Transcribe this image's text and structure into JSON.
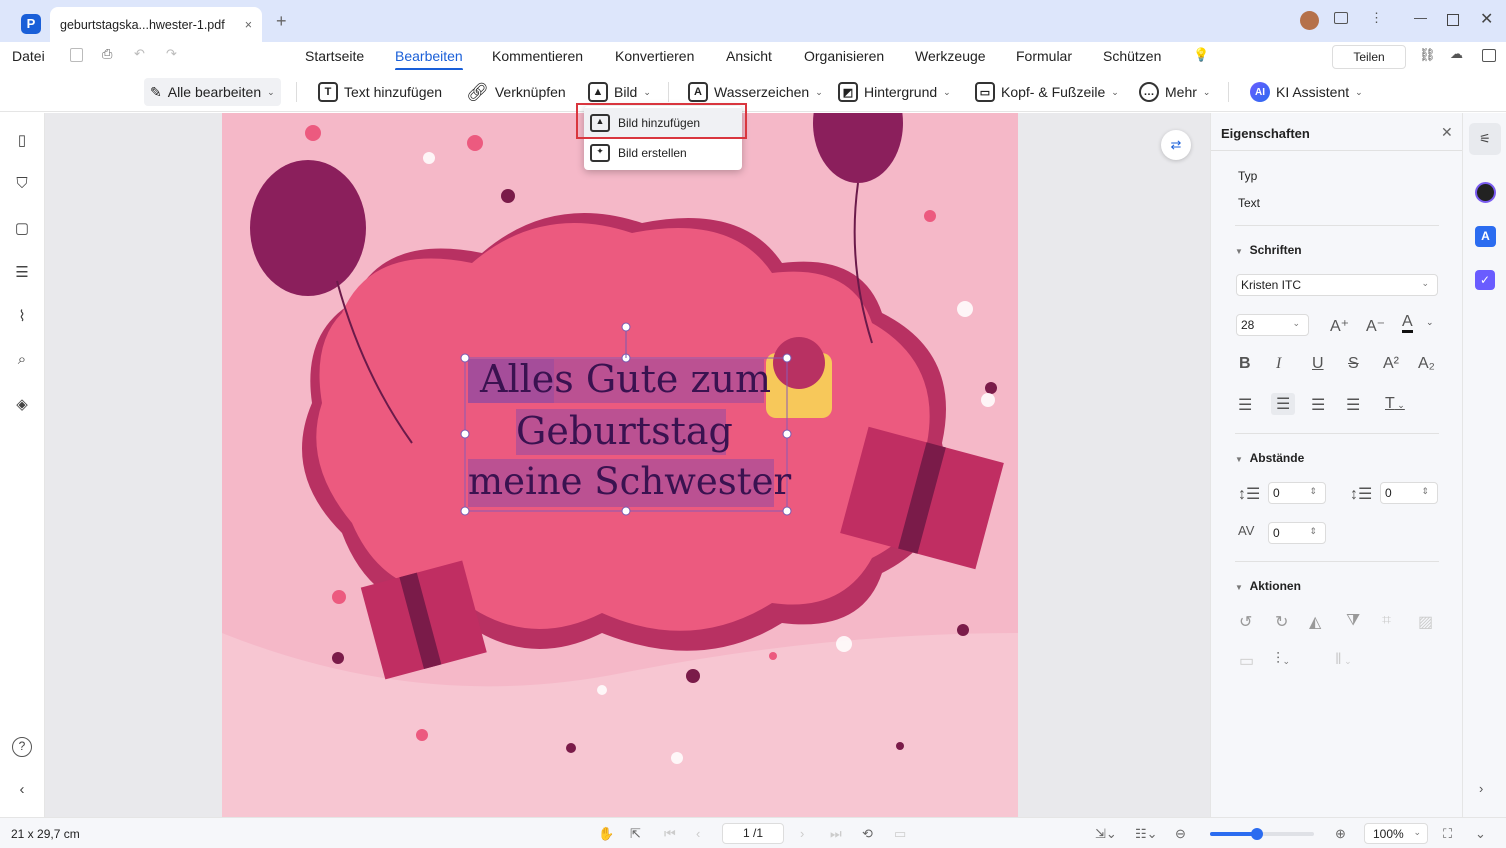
{
  "tab": {
    "title": "geburtstagska...hwester-1.pdf",
    "close": "×",
    "new": "+"
  },
  "menu": {
    "file": "Datei",
    "tabs": [
      "Startseite",
      "Bearbeiten",
      "Kommentieren",
      "Konvertieren",
      "Ansicht",
      "Organisieren",
      "Werkzeuge",
      "Formular",
      "Schützen"
    ],
    "active": "Bearbeiten",
    "share": "Teilen"
  },
  "toolbar": {
    "edit_all": "Alle bearbeiten",
    "add_text": "Text hinzufügen",
    "link": "Verknüpfen",
    "image": "Bild",
    "watermark": "Wasserzeichen",
    "background": "Hintergrund",
    "header_footer": "Kopf- & Fußzeile",
    "more": "Mehr",
    "ai": "KI Assistent"
  },
  "image_menu": {
    "items": [
      "Bild hinzufügen",
      "Bild erstellen"
    ],
    "highlighted": "Bild hinzufügen"
  },
  "document": {
    "text_lines": [
      "Alles Gute zum",
      "Geburtstag",
      "meine Schwester"
    ]
  },
  "panel": {
    "title": "Eigenschaften",
    "type_label": "Typ",
    "type_value": "Text",
    "fonts_section": "Schriften",
    "font": "Kristen ITC",
    "size": "28",
    "spacing_section": "Abstände",
    "line_spacing": "0",
    "para_spacing": "0",
    "char_spacing": "0",
    "actions_section": "Aktionen"
  },
  "status": {
    "page_size": "21 x 29,7 cm",
    "page": "1 /1",
    "zoom": "100%",
    "zoom_fraction": 0.45
  },
  "colors": {
    "accent": "#1a5fd8",
    "page_pink": "#f5b8c8",
    "blob": "#ec5a7f",
    "text": "#3a1250",
    "selection": "#9b4b9e"
  }
}
